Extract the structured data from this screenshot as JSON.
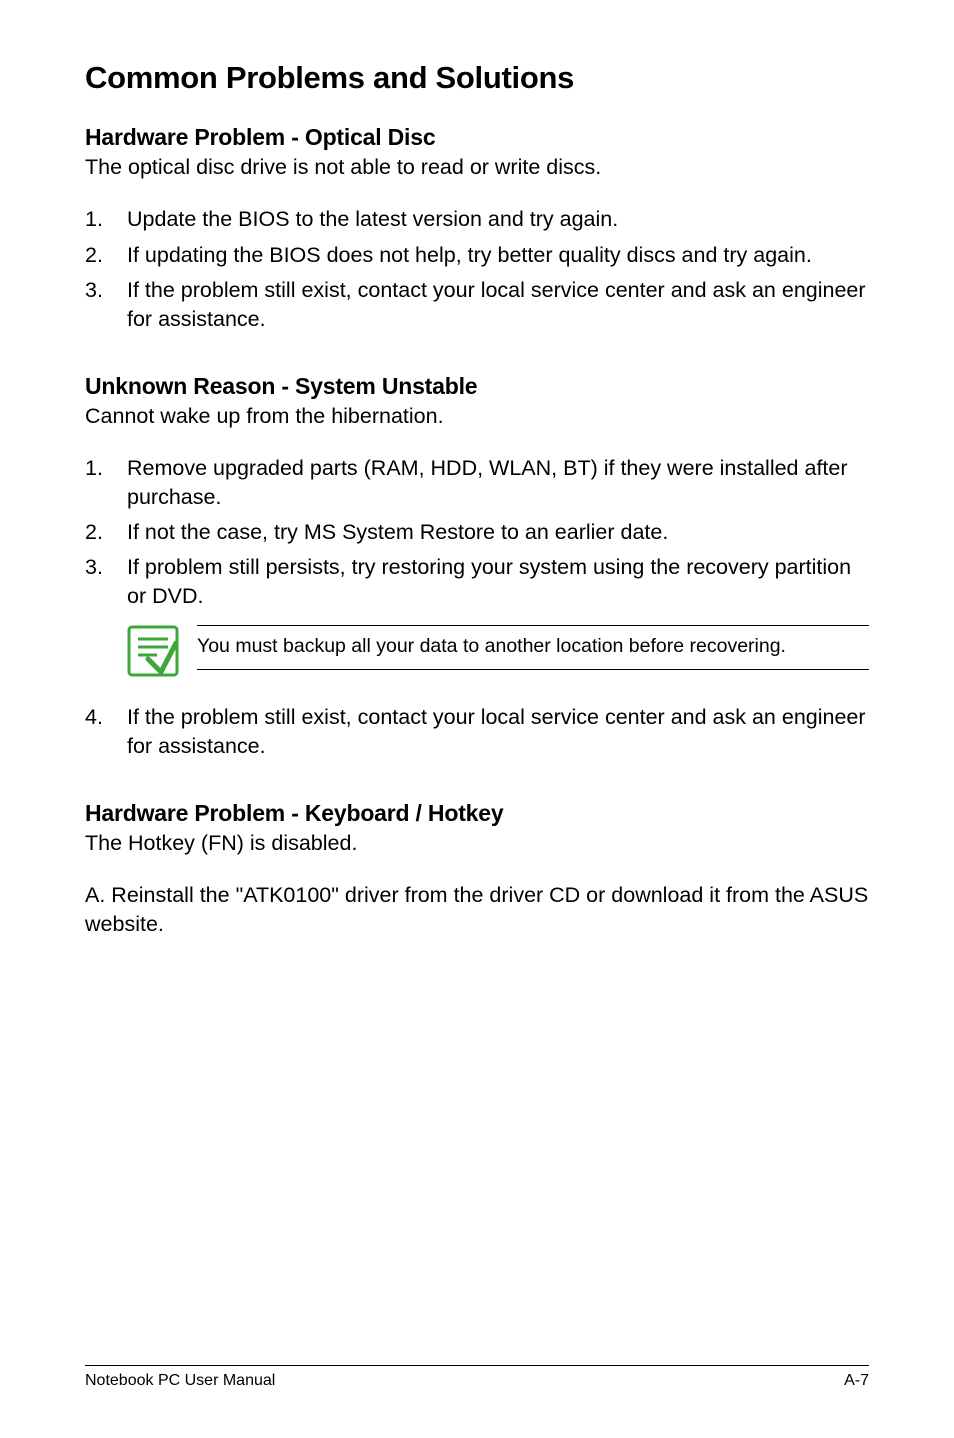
{
  "headings": {
    "main": "Common Problems and Solutions",
    "s1": "Hardware Problem - Optical Disc",
    "s2": "Unknown Reason - System Unstable",
    "s3": "Hardware Problem - Keyboard / Hotkey"
  },
  "section1": {
    "intro": "The optical disc drive is not able to read or write discs.",
    "items": [
      "Update the BIOS to the latest version and try again.",
      "If updating the BIOS does not help, try better quality discs and try again.",
      "If the problem still exist, contact your local service center and ask an engineer for assistance."
    ]
  },
  "section2": {
    "intro": "Cannot wake up from the hibernation.",
    "items_pre": [
      "Remove upgraded parts (RAM, HDD, WLAN, BT) if they were installed after purchase.",
      "If not the case, try MS System Restore to an earlier date.",
      "If problem still persists, try restoring your system using the recovery partition or DVD."
    ],
    "note": "You must backup all your data to another location before recovering.",
    "items_post": [
      "If the problem still exist, contact your local service center and ask an engineer for assistance."
    ]
  },
  "section3": {
    "intro": "The Hotkey (FN) is disabled.",
    "para": "A. Reinstall the \"ATK0100\" driver from the driver CD or download it from the ASUS website."
  },
  "footer": {
    "left": "Notebook PC User Manual",
    "right": "A-7"
  },
  "list_numbers": {
    "n1": "1.",
    "n2": "2.",
    "n3": "3.",
    "n4": "4."
  }
}
